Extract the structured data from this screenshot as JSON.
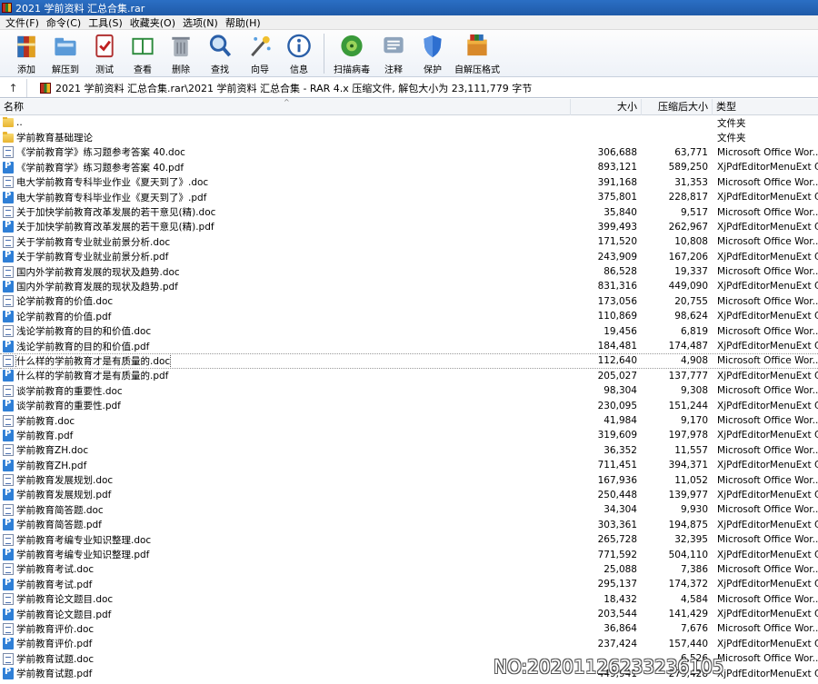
{
  "window": {
    "title": "2021 学前资料 汇总合集.rar"
  },
  "menu": [
    "文件(F)",
    "命令(C)",
    "工具(S)",
    "收藏夹(O)",
    "选项(N)",
    "帮助(H)"
  ],
  "toolbar": {
    "add": "添加",
    "extract": "解压到",
    "test": "测试",
    "view": "查看",
    "delete": "删除",
    "find": "查找",
    "wizard": "向导",
    "info": "信息",
    "virus": "扫描病毒",
    "comment": "注释",
    "protect": "保护",
    "sfx": "自解压格式"
  },
  "path": {
    "text": "2021 学前资料 汇总合集.rar\\2021 学前资料 汇总合集 - RAR 4.x 压缩文件, 解包大小为 23,111,779 字节"
  },
  "columns": {
    "name": "名称",
    "size": "大小",
    "packed": "压缩后大小",
    "type": "类型"
  },
  "files": [
    {
      "name": "..",
      "size": "",
      "packed": "",
      "type": "文件夹",
      "kind": "folder"
    },
    {
      "name": "学前教育基础理论",
      "size": "",
      "packed": "",
      "type": "文件夹",
      "kind": "folder"
    },
    {
      "name": "《学前教育学》练习题参考答案  40.doc",
      "size": "306,688",
      "packed": "63,771",
      "type": "Microsoft Office Wor...",
      "kind": "doc"
    },
    {
      "name": "《学前教育学》练习题参考答案  40.pdf",
      "size": "893,121",
      "packed": "589,250",
      "type": "XjPdfEditorMenuExt C...",
      "kind": "pdf"
    },
    {
      "name": "电大学前教育专科毕业作业《夏天到了》.doc",
      "size": "391,168",
      "packed": "31,353",
      "type": "Microsoft Office Wor...",
      "kind": "doc"
    },
    {
      "name": "电大学前教育专科毕业作业《夏天到了》.pdf",
      "size": "375,801",
      "packed": "228,817",
      "type": "XjPdfEditorMenuExt C...",
      "kind": "pdf"
    },
    {
      "name": "关于加快学前教育改革发展的若干意见(精).doc",
      "size": "35,840",
      "packed": "9,517",
      "type": "Microsoft Office Wor...",
      "kind": "doc"
    },
    {
      "name": "关于加快学前教育改革发展的若干意见(精).pdf",
      "size": "399,493",
      "packed": "262,967",
      "type": "XjPdfEditorMenuExt C...",
      "kind": "pdf"
    },
    {
      "name": "关于学前教育专业就业前景分析.doc",
      "size": "171,520",
      "packed": "10,808",
      "type": "Microsoft Office Wor...",
      "kind": "doc"
    },
    {
      "name": "关于学前教育专业就业前景分析.pdf",
      "size": "243,909",
      "packed": "167,206",
      "type": "XjPdfEditorMenuExt C...",
      "kind": "pdf"
    },
    {
      "name": "国内外学前教育发展的现状及趋势.doc",
      "size": "86,528",
      "packed": "19,337",
      "type": "Microsoft Office Wor...",
      "kind": "doc"
    },
    {
      "name": "国内外学前教育发展的现状及趋势.pdf",
      "size": "831,316",
      "packed": "449,090",
      "type": "XjPdfEditorMenuExt C...",
      "kind": "pdf"
    },
    {
      "name": "论学前教育的价值.doc",
      "size": "173,056",
      "packed": "20,755",
      "type": "Microsoft Office Wor...",
      "kind": "doc"
    },
    {
      "name": "论学前教育的价值.pdf",
      "size": "110,869",
      "packed": "98,624",
      "type": "XjPdfEditorMenuExt C...",
      "kind": "pdf"
    },
    {
      "name": "浅论学前教育的目的和价值.doc",
      "size": "19,456",
      "packed": "6,819",
      "type": "Microsoft Office Wor...",
      "kind": "doc"
    },
    {
      "name": "浅论学前教育的目的和价值.pdf",
      "size": "184,481",
      "packed": "174,487",
      "type": "XjPdfEditorMenuExt C...",
      "kind": "pdf"
    },
    {
      "name": "什么样的学前教育才是有质量的.doc",
      "size": "112,640",
      "packed": "4,908",
      "type": "Microsoft Office Wor...",
      "kind": "doc",
      "focused": true
    },
    {
      "name": "什么样的学前教育才是有质量的.pdf",
      "size": "205,027",
      "packed": "137,777",
      "type": "XjPdfEditorMenuExt C...",
      "kind": "pdf"
    },
    {
      "name": "谈学前教育的重要性.doc",
      "size": "98,304",
      "packed": "9,308",
      "type": "Microsoft Office Wor...",
      "kind": "doc"
    },
    {
      "name": "谈学前教育的重要性.pdf",
      "size": "230,095",
      "packed": "151,244",
      "type": "XjPdfEditorMenuExt C...",
      "kind": "pdf"
    },
    {
      "name": "学前教育.doc",
      "size": "41,984",
      "packed": "9,170",
      "type": "Microsoft Office Wor...",
      "kind": "doc"
    },
    {
      "name": "学前教育.pdf",
      "size": "319,609",
      "packed": "197,978",
      "type": "XjPdfEditorMenuExt C...",
      "kind": "pdf"
    },
    {
      "name": "学前教育ZH.doc",
      "size": "36,352",
      "packed": "11,557",
      "type": "Microsoft Office Wor...",
      "kind": "doc"
    },
    {
      "name": "学前教育ZH.pdf",
      "size": "711,451",
      "packed": "394,371",
      "type": "XjPdfEditorMenuExt C...",
      "kind": "pdf"
    },
    {
      "name": "学前教育发展规划.doc",
      "size": "167,936",
      "packed": "11,052",
      "type": "Microsoft Office Wor...",
      "kind": "doc"
    },
    {
      "name": "学前教育发展规划.pdf",
      "size": "250,448",
      "packed": "139,977",
      "type": "XjPdfEditorMenuExt C...",
      "kind": "pdf"
    },
    {
      "name": "学前教育简答题.doc",
      "size": "34,304",
      "packed": "9,930",
      "type": "Microsoft Office Wor...",
      "kind": "doc"
    },
    {
      "name": "学前教育简答题.pdf",
      "size": "303,361",
      "packed": "194,875",
      "type": "XjPdfEditorMenuExt C...",
      "kind": "pdf"
    },
    {
      "name": "学前教育考编专业知识整理.doc",
      "size": "265,728",
      "packed": "32,395",
      "type": "Microsoft Office Wor...",
      "kind": "doc"
    },
    {
      "name": "学前教育考编专业知识整理.pdf",
      "size": "771,592",
      "packed": "504,110",
      "type": "XjPdfEditorMenuExt C...",
      "kind": "pdf"
    },
    {
      "name": "学前教育考试.doc",
      "size": "25,088",
      "packed": "7,386",
      "type": "Microsoft Office Wor...",
      "kind": "doc"
    },
    {
      "name": "学前教育考试.pdf",
      "size": "295,137",
      "packed": "174,372",
      "type": "XjPdfEditorMenuExt C...",
      "kind": "pdf"
    },
    {
      "name": "学前教育论文题目.doc",
      "size": "18,432",
      "packed": "4,584",
      "type": "Microsoft Office Wor...",
      "kind": "doc"
    },
    {
      "name": "学前教育论文题目.pdf",
      "size": "203,544",
      "packed": "141,429",
      "type": "XjPdfEditorMenuExt C...",
      "kind": "pdf"
    },
    {
      "name": "学前教育评价.doc",
      "size": "36,864",
      "packed": "7,676",
      "type": "Microsoft Office Wor...",
      "kind": "doc"
    },
    {
      "name": "学前教育评价.pdf",
      "size": "237,424",
      "packed": "157,440",
      "type": "XjPdfEditorMenuExt C...",
      "kind": "pdf"
    },
    {
      "name": "学前教育试题.doc",
      "size": "",
      "packed": "6,526",
      "type": "Microsoft Office Wor...",
      "kind": "doc"
    },
    {
      "name": "学前教育试题.pdf",
      "size": "449,941",
      "packed": "279,428",
      "type": "XjPdfEditorMenuExt C...",
      "kind": "pdf"
    }
  ],
  "watermark": "NO:20201126233236105"
}
